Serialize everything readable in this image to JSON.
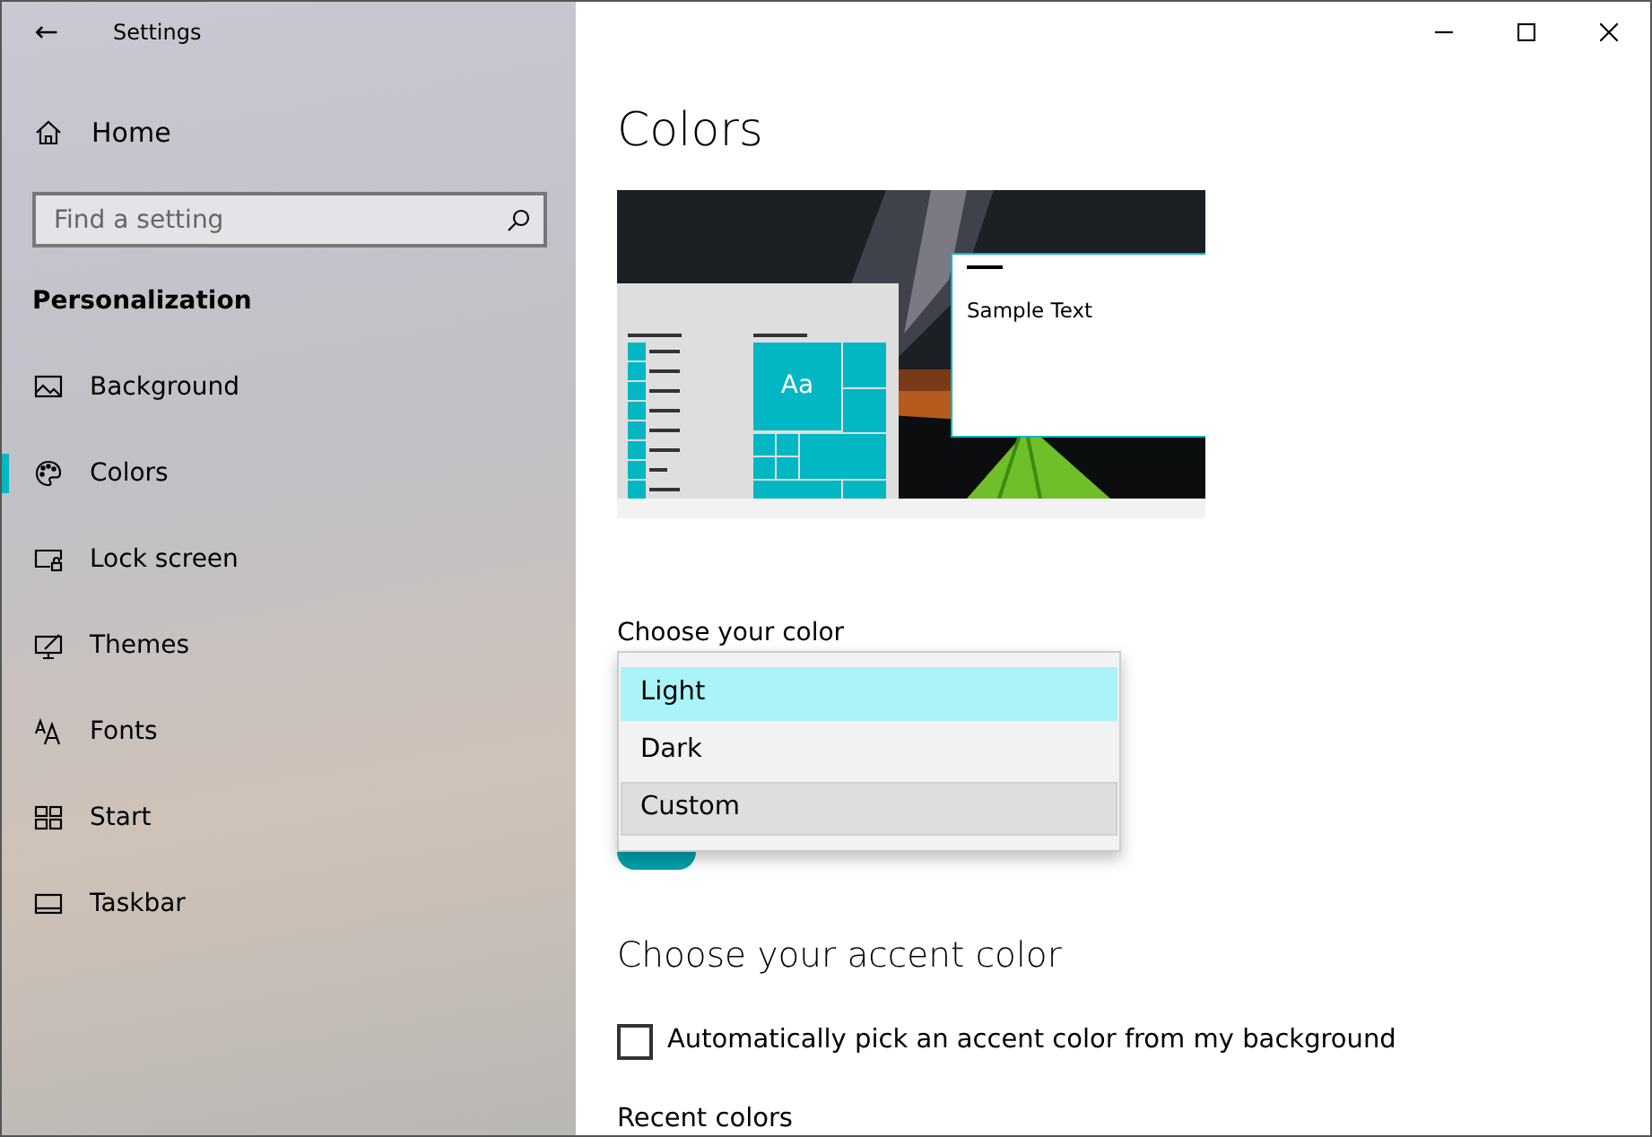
{
  "window": {
    "title": "Settings",
    "back": "←"
  },
  "sidebar": {
    "home": "Home",
    "search": {
      "placeholder": "Find a setting"
    },
    "section": "Personalization",
    "items": [
      {
        "label": "Background",
        "selected": false
      },
      {
        "label": "Colors",
        "selected": true
      },
      {
        "label": "Lock screen",
        "selected": false
      },
      {
        "label": "Themes",
        "selected": false
      },
      {
        "label": "Fonts",
        "selected": false
      },
      {
        "label": "Start",
        "selected": false
      },
      {
        "label": "Taskbar",
        "selected": false
      }
    ]
  },
  "page": {
    "title": "Colors",
    "preview": {
      "tile_text": "Aa",
      "sample_text": "Sample Text"
    },
    "color_label": "Choose your color",
    "color_menu": [
      {
        "label": "Light",
        "selected": true,
        "hovered": false
      },
      {
        "label": "Dark",
        "selected": false,
        "hovered": false
      },
      {
        "label": "Custom",
        "selected": false,
        "hovered": true
      }
    ],
    "toggle": {
      "on": true
    },
    "accent_heading": "Choose your accent color",
    "auto_accent": {
      "label": "Automatically pick an accent color from my background",
      "checked": false
    },
    "recent_label": "Recent colors"
  }
}
